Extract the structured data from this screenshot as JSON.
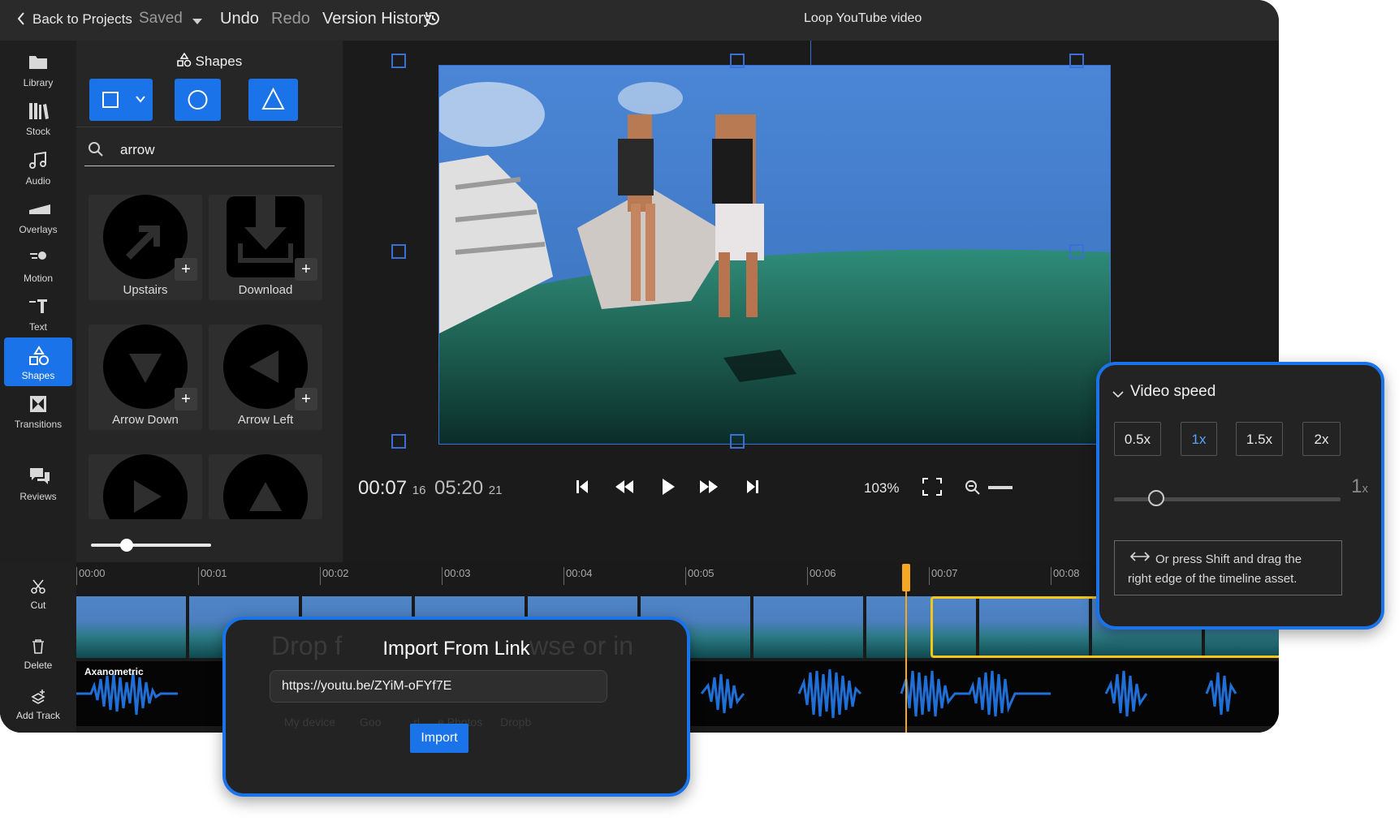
{
  "topbar": {
    "back": "Back to Projects",
    "saved": "Saved",
    "undo": "Undo",
    "redo": "Redo",
    "version_history": "Version History",
    "project_title": "Loop YouTube video"
  },
  "sidebar": {
    "items": [
      {
        "label": "Library",
        "icon": "folder-icon"
      },
      {
        "label": "Stock",
        "icon": "stock-icon"
      },
      {
        "label": "Audio",
        "icon": "music-icon"
      },
      {
        "label": "Overlays",
        "icon": "overlay-icon"
      },
      {
        "label": "Motion",
        "icon": "motion-icon"
      },
      {
        "label": "Text",
        "icon": "text-icon"
      },
      {
        "label": "Shapes",
        "icon": "shapes-icon",
        "active": true
      },
      {
        "label": "Transitions",
        "icon": "transitions-icon"
      },
      {
        "label": "Reviews",
        "icon": "reviews-icon"
      }
    ]
  },
  "panel": {
    "title": "Shapes",
    "search_value": "arrow",
    "shapes": [
      {
        "label": "Upstairs",
        "icon": "upstairs-arrow-icon"
      },
      {
        "label": "Download",
        "icon": "download-icon"
      },
      {
        "label": "Arrow Down",
        "icon": "arrow-down-icon"
      },
      {
        "label": "Arrow Left",
        "icon": "arrow-left-icon"
      },
      {
        "label": "",
        "icon": "arrow-right-icon"
      },
      {
        "label": "",
        "icon": "arrow-up-icon"
      }
    ],
    "plus": "+",
    "slider_value": 0.3
  },
  "player": {
    "current_time": "00:07",
    "current_frame": "16",
    "total_time": "05:20",
    "total_frame": "21",
    "zoom": "103%"
  },
  "timeline": {
    "tools": [
      {
        "label": "Cut",
        "icon": "scissors-icon"
      },
      {
        "label": "Delete",
        "icon": "trash-icon"
      },
      {
        "label": "Add Track",
        "icon": "add-track-icon"
      }
    ],
    "ticks": [
      "00:00",
      "00:01",
      "00:02",
      "00:03",
      "00:04",
      "00:05",
      "00:06",
      "00:07",
      "00:08"
    ],
    "audio_label": "Axanometric",
    "bg_text_1": "Drop f",
    "bg_text_2": "wse or in",
    "bg_sources": [
      "My device",
      "Goo",
      "rl",
      "e Photos",
      "Dropb"
    ]
  },
  "import_modal": {
    "title": "Import From Link",
    "url_value": "https://youtu.be/ZYiM-oFYf7E",
    "button": "Import"
  },
  "speed_popup": {
    "title": "Video speed",
    "options": [
      "0.5x",
      "1x",
      "1.5x",
      "2x"
    ],
    "selected": "1x",
    "value_number": "1",
    "value_unit": "x",
    "hint_line1": "Or press Shift and drag the",
    "hint_line2": "right edge of the timeline asset."
  },
  "colors": {
    "accent": "#1a73e8",
    "playhead": "#f5a623",
    "waveform": "#1f6fd6"
  }
}
